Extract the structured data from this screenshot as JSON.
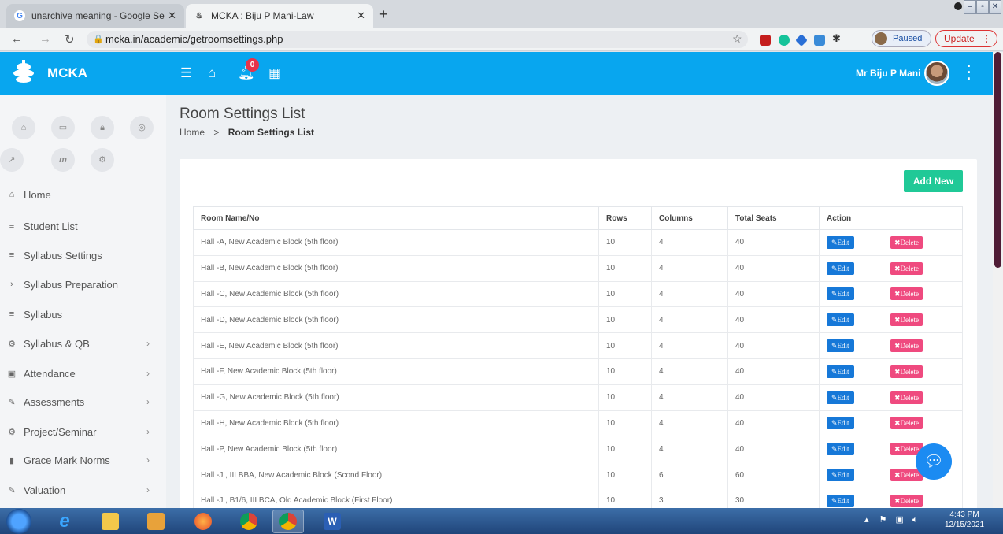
{
  "browser": {
    "tabs": [
      {
        "title": "unarchive meaning - Google Sea",
        "active": false
      },
      {
        "title": "MCKA : Biju P Mani-Law",
        "active": true
      }
    ],
    "url": "mcka.in/academic/getroomsettings.php",
    "paused_label": "Paused",
    "update_label": "Update"
  },
  "app": {
    "name": "MCKA",
    "notification_count": "0",
    "user_name": "Mr Biju P Mani"
  },
  "sidebar": {
    "items": [
      {
        "label": "Home",
        "icon": "home-icon",
        "chevron": false
      },
      {
        "label": "Student List",
        "icon": "list-icon",
        "chevron": false
      },
      {
        "label": "Syllabus Settings",
        "icon": "list-icon",
        "chevron": false
      },
      {
        "label": "Syllabus Preparation",
        "icon": "chevron-right-icon",
        "chevron": false
      },
      {
        "label": "Syllabus",
        "icon": "list-icon",
        "chevron": false
      },
      {
        "label": "Syllabus & QB",
        "icon": "gears-icon",
        "chevron": true
      },
      {
        "label": "Attendance",
        "icon": "calendar-icon",
        "chevron": true
      },
      {
        "label": "Assessments",
        "icon": "pencil-icon",
        "chevron": true
      },
      {
        "label": "Project/Seminar",
        "icon": "gears-icon",
        "chevron": true
      },
      {
        "label": "Grace Mark Norms",
        "icon": "book-icon",
        "chevron": true
      },
      {
        "label": "Valuation",
        "icon": "pencil-icon",
        "chevron": true
      }
    ]
  },
  "page": {
    "title": "Room Settings List",
    "breadcrumb_home": "Home",
    "breadcrumb_sep": ">",
    "breadcrumb_current": "Room Settings List",
    "add_new_label": "Add New"
  },
  "table": {
    "headers": [
      "Room Name/No",
      "Rows",
      "Columns",
      "Total Seats",
      "Action"
    ],
    "edit_label": "Edit",
    "delete_label": "Delete",
    "rows": [
      {
        "room": "Hall -A, New Academic Block (5th floor)",
        "rows": "10",
        "columns": "4",
        "seats": "40"
      },
      {
        "room": "Hall -B, New Academic Block (5th floor)",
        "rows": "10",
        "columns": "4",
        "seats": "40"
      },
      {
        "room": "Hall -C, New Academic Block (5th floor)",
        "rows": "10",
        "columns": "4",
        "seats": "40"
      },
      {
        "room": "Hall -D, New Academic Block (5th floor)",
        "rows": "10",
        "columns": "4",
        "seats": "40"
      },
      {
        "room": "Hall -E, New Academic Block (5th floor)",
        "rows": "10",
        "columns": "4",
        "seats": "40"
      },
      {
        "room": "Hall -F, New Academic Block (5th floor)",
        "rows": "10",
        "columns": "4",
        "seats": "40"
      },
      {
        "room": "Hall -G, New Academic Block (5th floor)",
        "rows": "10",
        "columns": "4",
        "seats": "40"
      },
      {
        "room": "Hall -H, New Academic Block (5th floor)",
        "rows": "10",
        "columns": "4",
        "seats": "40"
      },
      {
        "room": "Hall -P, New Academic Block (5th floor)",
        "rows": "10",
        "columns": "4",
        "seats": "40"
      },
      {
        "room": "Hall -J , III BBA, New Academic Block (Scond Floor)",
        "rows": "10",
        "columns": "6",
        "seats": "60"
      },
      {
        "room": "Hall -J , B1/6, III BCA, Old Academic Block (First Floor)",
        "rows": "10",
        "columns": "3",
        "seats": "30"
      }
    ]
  },
  "taskbar": {
    "time": "4:43 PM",
    "date": "12/15/2021"
  },
  "colors": {
    "header": "#08a6ef",
    "add_new": "#20c997",
    "edit": "#1678d8",
    "delete": "#ef4a7f"
  }
}
